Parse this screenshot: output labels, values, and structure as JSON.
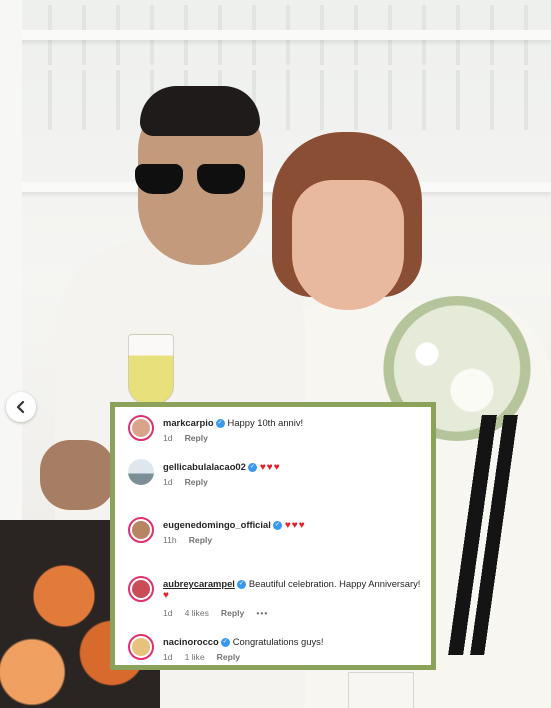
{
  "comments": [
    {
      "username": "markcarpio",
      "text": "Happy 10th anniv!",
      "hearts": "",
      "time": "1d",
      "likes": "",
      "reply": "Reply",
      "more": "",
      "avatar_color": "#d9a58a",
      "ring": true
    },
    {
      "username": "gellicabulalacao02",
      "text": "",
      "hearts": "♥♥♥",
      "time": "1d",
      "likes": "",
      "reply": "Reply",
      "more": "",
      "avatar_color": "#9fb7c9",
      "ring": false
    },
    {
      "username": "eugenedomingo_official",
      "text": "",
      "hearts": "♥♥♥",
      "time": "11h",
      "likes": "",
      "reply": "Reply",
      "more": "",
      "avatar_color": "#b88463",
      "ring": true
    },
    {
      "username": "aubreycarampel",
      "text": "Beautiful celebration. Happy Anniversary!",
      "hearts": "♥",
      "time": "1d",
      "likes": "4 likes",
      "reply": "Reply",
      "more": "•••",
      "avatar_color": "#c94d56",
      "ring": true
    },
    {
      "username": "nacinorocco",
      "text": "Congratulations guys!",
      "hearts": "",
      "time": "1d",
      "likes": "1 like",
      "reply": "Reply",
      "more": "",
      "avatar_color": "#e7c27a",
      "ring": true
    }
  ],
  "colors": {
    "panel_border": "#8aa259",
    "verified": "#3897f0",
    "heart": "#ed1c24"
  }
}
